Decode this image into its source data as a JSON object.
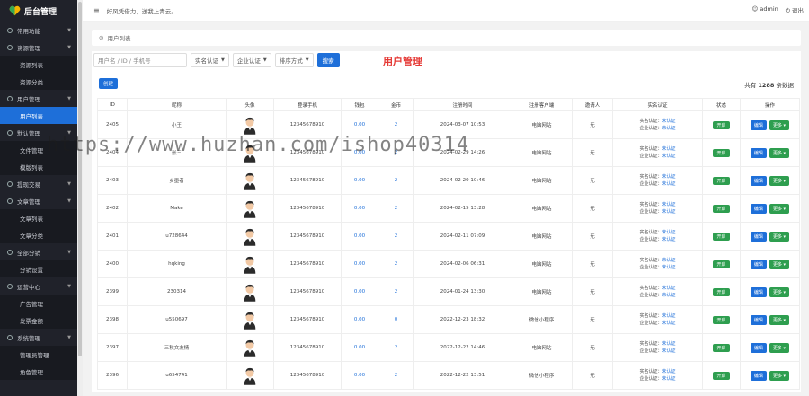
{
  "app_title": "后台管理",
  "topbar": {
    "welcome": "好风凭借力，送我上青云。",
    "user": "admin",
    "logout": "退出"
  },
  "sidebar": {
    "items": [
      {
        "label": "常用功能",
        "type": "group"
      },
      {
        "label": "资源管理",
        "type": "group"
      },
      {
        "label": "资源列表",
        "type": "sub"
      },
      {
        "label": "资源分类",
        "type": "sub"
      },
      {
        "label": "用户管理",
        "type": "group"
      },
      {
        "label": "用户列表",
        "type": "sub",
        "active": true
      },
      {
        "label": "默认管理",
        "type": "group"
      },
      {
        "label": "文件管理",
        "type": "sub"
      },
      {
        "label": "模版列表",
        "type": "sub"
      },
      {
        "label": "提现交易",
        "type": "group"
      },
      {
        "label": "文章管理",
        "type": "group"
      },
      {
        "label": "文章列表",
        "type": "sub"
      },
      {
        "label": "文章分类",
        "type": "sub"
      },
      {
        "label": "全部分销",
        "type": "group"
      },
      {
        "label": "分销设置",
        "type": "sub"
      },
      {
        "label": "运营中心",
        "type": "group"
      },
      {
        "label": "广告管理",
        "type": "sub"
      },
      {
        "label": "发票金额",
        "type": "sub"
      },
      {
        "label": "系统管理",
        "type": "group"
      },
      {
        "label": "管理员管理",
        "type": "sub"
      },
      {
        "label": "角色管理",
        "type": "sub"
      }
    ]
  },
  "breadcrumb": "用户列表",
  "filters": {
    "search_placeholder": "用户名 / ID / 手机号",
    "select1": "实名认证",
    "select2": "企业认证",
    "select3": "排序方式",
    "search_button": "搜索"
  },
  "page_heading": "用户管理",
  "create_button": "创建",
  "total": {
    "prefix": "共有",
    "count": "1288",
    "suffix": "条数据"
  },
  "table": {
    "headers": [
      "ID",
      "昵称",
      "头像",
      "登录手机",
      "钱包",
      "金币",
      "注册时间",
      "注册客户端",
      "邀请人",
      "实名认证",
      "状态",
      "操作"
    ],
    "cert_prefix1": "实名认证：",
    "cert_prefix2": "企业认证：",
    "cert_value": "未认证",
    "status_label": "开启",
    "edit_label": "编辑",
    "more_label": "更多",
    "rows": [
      {
        "id": "2405",
        "nick": "小王",
        "phone": "12345678910",
        "wallet": "0.00",
        "coins": "2",
        "reg_time": "2024-03-07 10:53",
        "client": "电脑网站",
        "inviter": "无"
      },
      {
        "id": "2404",
        "nick": "张三",
        "phone": "12345678910",
        "wallet": "0.00",
        "coins": "2",
        "reg_time": "2024-02-29 14:26",
        "client": "电脑网站",
        "inviter": "无"
      },
      {
        "id": "2403",
        "nick": "乡墨者",
        "phone": "12345678910",
        "wallet": "0.00",
        "coins": "2",
        "reg_time": "2024-02-20 10:46",
        "client": "电脑网站",
        "inviter": "无"
      },
      {
        "id": "2402",
        "nick": "Make",
        "phone": "12345678910",
        "wallet": "0.00",
        "coins": "2",
        "reg_time": "2024-02-15 13:28",
        "client": "电脑网站",
        "inviter": "无"
      },
      {
        "id": "2401",
        "nick": "u728644",
        "phone": "12345678910",
        "wallet": "0.00",
        "coins": "2",
        "reg_time": "2024-02-11 07:09",
        "client": "电脑网站",
        "inviter": "无"
      },
      {
        "id": "2400",
        "nick": "hqking",
        "phone": "12345678910",
        "wallet": "0.00",
        "coins": "2",
        "reg_time": "2024-02-06 06:31",
        "client": "电脑网站",
        "inviter": "无"
      },
      {
        "id": "2399",
        "nick": "230314",
        "phone": "12345678910",
        "wallet": "0.00",
        "coins": "2",
        "reg_time": "2024-01-24 13:30",
        "client": "电脑网站",
        "inviter": "无"
      },
      {
        "id": "2398",
        "nick": "u550697",
        "phone": "12345678910",
        "wallet": "0.00",
        "coins": "0",
        "reg_time": "2022-12-23 18:32",
        "client": "微信小程序",
        "inviter": "无"
      },
      {
        "id": "2397",
        "nick": "三秋文友情",
        "phone": "12345678910",
        "wallet": "0.00",
        "coins": "2",
        "reg_time": "2022-12-22 14:46",
        "client": "电脑网站",
        "inviter": "无"
      },
      {
        "id": "2396",
        "nick": "u654741",
        "phone": "12345678910",
        "wallet": "0.00",
        "coins": "2",
        "reg_time": "2022-12-22 13:51",
        "client": "微信小程序",
        "inviter": "无"
      }
    ]
  },
  "watermark": "https://www.huzhan.com/ishop40314",
  "colors": {
    "primary": "#1e6fd9",
    "success": "#2e9e4f",
    "sidebar": "#20222a",
    "heading": "#e53935"
  }
}
